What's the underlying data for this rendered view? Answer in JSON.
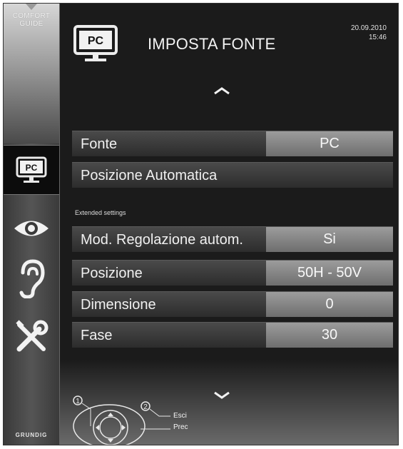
{
  "sidebar": {
    "comfort_label": "COMFORT\nGUIDE",
    "brand": "GRUNDIG",
    "items": [
      {
        "icon": "pc-monitor-icon",
        "label": "PC"
      },
      {
        "icon": "eye-icon"
      },
      {
        "icon": "ear-icon"
      },
      {
        "icon": "tools-icon"
      }
    ]
  },
  "header": {
    "icon_label": "PC",
    "title": "IMPOSTA FONTE",
    "date": "20.09.2010",
    "time": "15:46"
  },
  "menu": {
    "rows": [
      {
        "label": "Fonte",
        "value": "PC"
      },
      {
        "label": "Posizione Automatica",
        "value": ""
      }
    ],
    "extended_label": "Extended settings",
    "extended_rows": [
      {
        "label": "Mod. Regolazione autom.",
        "value": "Si"
      },
      {
        "label": "Posizione",
        "value": "50H - 50V"
      },
      {
        "label": "Dimensione",
        "value": "0"
      },
      {
        "label": "Fase",
        "value": "30"
      }
    ]
  },
  "navigation": {
    "key1": "1",
    "key2": "2",
    "exit_label": "Esci",
    "back_label": "Prec"
  },
  "colors": {
    "background": "#1b1b1b",
    "row": "#3a3a3a",
    "value_box": "#8a8a8a",
    "text": "#f0f0f0"
  }
}
